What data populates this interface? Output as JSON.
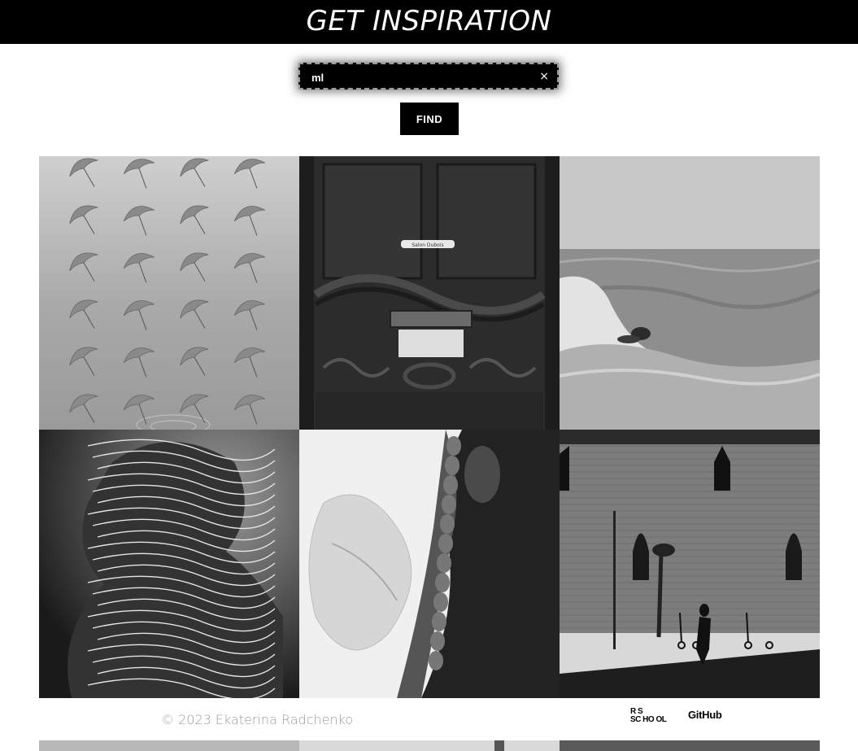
{
  "header": {
    "title": "GET INSPIRATION"
  },
  "search": {
    "value": "ml",
    "clear_symbol": "×",
    "find_label": "FIND"
  },
  "gallery": {
    "photos": [
      {
        "subject": "umbrellas"
      },
      {
        "subject": "wooden door mail slot",
        "plate_text": "Salon Dubois"
      },
      {
        "subject": "surfer on wave"
      },
      {
        "subject": "abstract head sculpture"
      },
      {
        "subject": "woman with braid"
      },
      {
        "subject": "brick wall with scooters"
      }
    ]
  },
  "footer": {
    "copyright": "© 2023 Ekaterina Radchenko",
    "school_logo": {
      "line1": "R  S",
      "line2": "SC HO OL"
    },
    "github_label": "GitHub"
  }
}
